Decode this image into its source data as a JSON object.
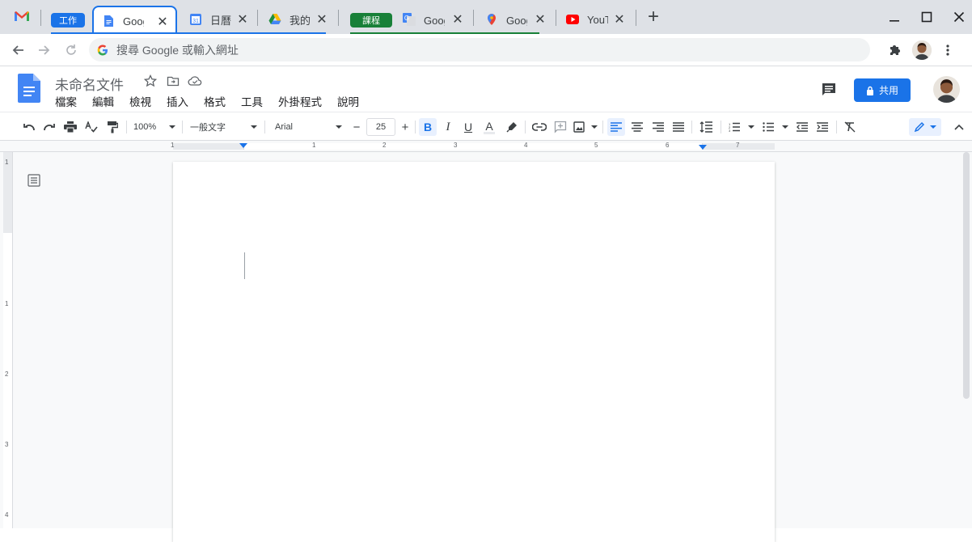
{
  "browser": {
    "tabs": [
      {
        "title": "Google 文件",
        "favicon": "docs-icon"
      },
      {
        "title": "日曆",
        "favicon": "calendar-icon"
      },
      {
        "title": "我的雲端硬碟",
        "favicon": "drive-icon"
      },
      {
        "title": "Google 翻譯",
        "favicon": "translate-icon"
      },
      {
        "title": "Google 地圖",
        "favicon": "maps-icon"
      },
      {
        "title": "YouTube",
        "favicon": "youtube-icon"
      }
    ],
    "groups": {
      "work": {
        "label": "工作",
        "color": "#1a73e8"
      },
      "course": {
        "label": "課程",
        "color": "#188038"
      }
    },
    "close_glyph": "✕",
    "new_tab_glyph": "+",
    "omnibox_placeholder": "搜尋 Google 或輸入網址"
  },
  "docs": {
    "doc_title": "未命名文件",
    "menu": [
      "檔案",
      "編輯",
      "檢視",
      "插入",
      "格式",
      "工具",
      "外掛程式",
      "說明"
    ],
    "share_label": "共用"
  },
  "format_toolbar": {
    "zoom": "100%",
    "style": "一般文字",
    "font": "Arial",
    "font_size": "25",
    "bold": "B",
    "italic": "I",
    "underline": "U",
    "text_color": "A",
    "minus": "−",
    "plus": "+"
  },
  "ruler": {
    "h_numbers": [
      "1",
      "1",
      "2",
      "3",
      "4",
      "5",
      "6",
      "7"
    ],
    "v_numbers": [
      "1",
      "1",
      "2",
      "3",
      "4"
    ]
  },
  "colors": {
    "accent": "#1a73e8",
    "tabbar": "#dee1e6"
  }
}
